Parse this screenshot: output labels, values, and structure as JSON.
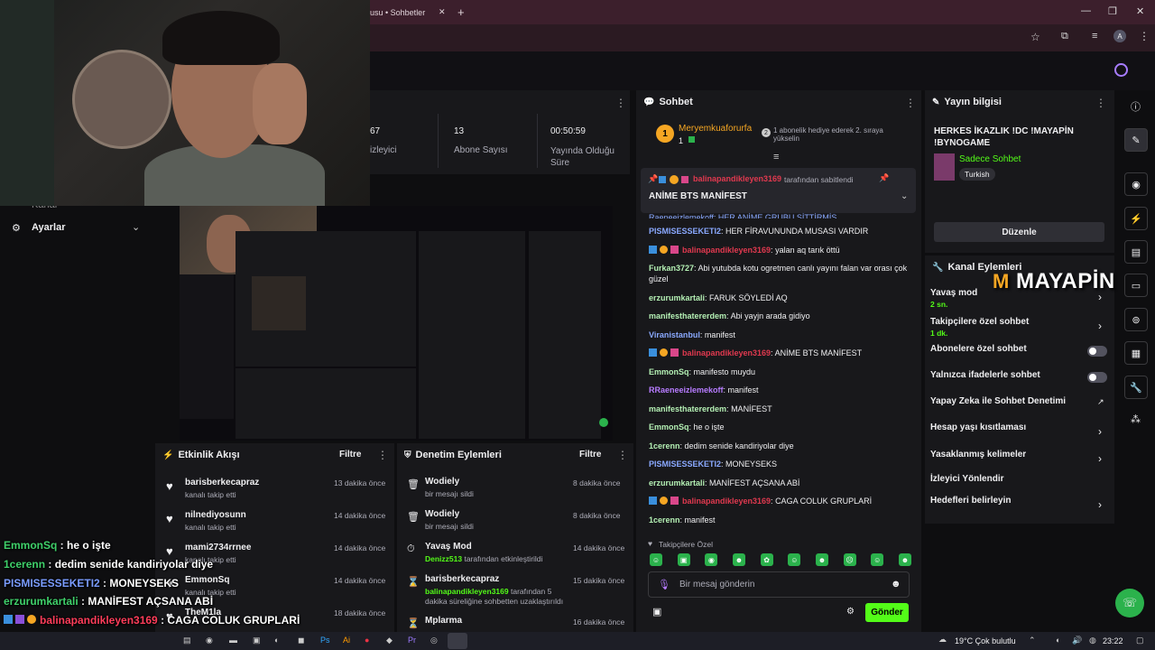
{
  "browser": {
    "tab_title": "usu • Sohbetler",
    "new_tab": "+",
    "window_controls": [
      "—",
      "❐",
      "✕"
    ]
  },
  "left_nav": {
    "item_partial": "Kanal",
    "settings": "Ayarlar"
  },
  "stats": [
    {
      "value": "67",
      "label": "izleyici"
    },
    {
      "value": "13",
      "label": "Abone Sayısı"
    },
    {
      "value": "00:50:59",
      "label": "Yayında Olduğu Süre"
    }
  ],
  "activity": {
    "title": "Etkinlik Akışı",
    "filter": "Filtre",
    "items": [
      {
        "name": "barisberkecapraz",
        "sub": "kanalı takip etti",
        "time": "13 dakika önce"
      },
      {
        "name": "nilnediyosunn",
        "sub": "kanalı takip etti",
        "time": "14 dakika önce"
      },
      {
        "name": "mami2734rrnee",
        "sub": "kanalı takip etti",
        "time": "14 dakika önce"
      },
      {
        "name": "EmmonSq",
        "sub": "kanalı takip etti",
        "time": "14 dakika önce"
      },
      {
        "name": "TheM1la",
        "sub": "",
        "time": "18 dakika önce"
      }
    ]
  },
  "moderation": {
    "title": "Denetim Eylemleri",
    "filter": "Filtre",
    "items": [
      {
        "name": "Wodiely",
        "sub": "bir mesajı sildi",
        "time": "8 dakika önce"
      },
      {
        "name": "Wodiely",
        "sub": "bir mesajı sildi",
        "time": "8 dakika önce"
      },
      {
        "name": "Yavaş Mod",
        "sub_user": "Denizz513",
        "sub": "tarafından etkinleştirildi",
        "time": "14 dakika önce"
      },
      {
        "name": "barisberkecapraz",
        "sub_user": "balinapandikleyen3169",
        "sub": "tarafından 5 dakika süreliğine sohbetten uzaklaştırıldı",
        "time": "15 dakika önce"
      },
      {
        "name": "Mplarma",
        "sub": "",
        "time": "16 dakika önce"
      }
    ]
  },
  "chat": {
    "title": "Sohbet",
    "gifter_name": "Meryemkuaforurfa",
    "gifter_count": "1",
    "gift_text": "1 abonelik hediye ederek 2. sıraya yükselin",
    "pinned_by": "balinapandikleyen3169",
    "pinned_suffix": "tarafından sabitlendi",
    "pinned_message": "ANİME BTS MANİFEST",
    "messages": [
      {
        "user": "PISMISESSEKETI2",
        "text": "HER FİRAVUNUNDA MUSASI VARDIR",
        "color": "#8aa9ff"
      },
      {
        "user": "balinapandikleyen3169",
        "text": "yalan aq tarık öttü",
        "color": "#e0394f",
        "badges": true
      },
      {
        "user": "Furkan3727",
        "text": "Abi yutubda kotu ogretmen canlı yayını falan var orası çok güzel",
        "color": "#b4f0b4"
      },
      {
        "user": "erzurumkartali",
        "text": "FARUK SÖYLEDİ AQ",
        "color": "#b4f0b4"
      },
      {
        "user": "manifesthatererdem",
        "text": "Abi yayjn arada gidiyo",
        "color": "#b4f0b4"
      },
      {
        "user": "Viranistanbul",
        "text": "manifest",
        "color": "#8aa9ff"
      },
      {
        "user": "balinapandikleyen3169",
        "text": "ANİME BTS MANİFEST",
        "color": "#e0394f",
        "badges": true
      },
      {
        "user": "EmmonSq",
        "text": "manifesto muydu",
        "color": "#b4f0b4"
      },
      {
        "user": "RRaeneeizlemekoff",
        "text": "manifest",
        "color": "#b77cff"
      },
      {
        "user": "manifesthatererdem",
        "text": "MANİFEST",
        "color": "#b4f0b4"
      },
      {
        "user": "EmmonSq",
        "text": "he o işte",
        "color": "#b4f0b4"
      },
      {
        "user": "1cerenn",
        "text": "dedim senide kandiriyolar diye",
        "color": "#b4f0b4"
      },
      {
        "user": "PISMISESSEKETI2",
        "text": "MONEYSEKS",
        "color": "#8aa9ff"
      },
      {
        "user": "erzurumkartali",
        "text": "MANİFEST AÇSANA ABİ",
        "color": "#b4f0b4"
      },
      {
        "user": "balinapandikleyen3169",
        "text": "CAGA COLUK GRUPLARİ",
        "color": "#e0394f",
        "badges": true
      },
      {
        "user": "1cerenn",
        "text": "manifest",
        "color": "#b4f0b4"
      }
    ],
    "followers_only": "Takipçilere Özel",
    "input_placeholder": "Bir mesaj gönderin",
    "send_label": "Gönder"
  },
  "stream_info": {
    "title_label": "Yayın bilgisi",
    "stream_title": "HERKES İKAZLIK !DC !MAYAPİN !BYNOGAME",
    "category": "Sadece Sohbet",
    "tag": "Turkish",
    "edit_label": "Düzenle"
  },
  "channel_actions": {
    "title": "Kanal Eylemleri",
    "items": [
      {
        "label": "Yavaş mod",
        "sub": "2 sn.",
        "control": "chevron"
      },
      {
        "label": "Takipçilere özel sohbet",
        "sub": "1 dk.",
        "control": "chevron"
      },
      {
        "label": "Abonelere özel sohbet",
        "sub": "",
        "control": "toggle"
      },
      {
        "label": "Yalnızca ifadelerle sohbet",
        "sub": "",
        "control": "toggle"
      },
      {
        "label": "Yapay Zeka ile Sohbet Denetimi",
        "sub": "",
        "control": "external"
      },
      {
        "label": "Hesap yaşı kısıtlaması",
        "sub": "",
        "control": "chevron"
      },
      {
        "label": "Yasaklanmış kelimeler",
        "sub": "",
        "control": "chevron"
      },
      {
        "label": "İzleyici Yönlendir",
        "sub": "",
        "control": "none"
      },
      {
        "label": "Hedefleri belirleyin",
        "sub": "",
        "control": "chevron"
      }
    ]
  },
  "watermark": "MAYAPİN",
  "overlay_chat": [
    {
      "user": "EmmonSq",
      "text": "he o işte",
      "color": "#3fd06a"
    },
    {
      "user": "1cerenn",
      "text": "dedim senide kandiriyolar diye",
      "color": "#3fd06a"
    },
    {
      "user": "PISMISESSEKETI2",
      "text": "MONEYSEKS",
      "color": "#7a9cff"
    },
    {
      "user": "erzurumkartali",
      "text": "MANİFEST AÇSANA ABİ",
      "color": "#3fd06a"
    },
    {
      "user": "balinapandikleyen3169",
      "text": "CAGA COLUK GRUPLARİ",
      "color": "#ff3d5a"
    },
    {
      "user": "1cerenn",
      "text": "manifest",
      "color": "#3fd06a"
    }
  ],
  "taskbar": {
    "weather": "19°C  Çok bulutlu",
    "time": "23:22"
  }
}
